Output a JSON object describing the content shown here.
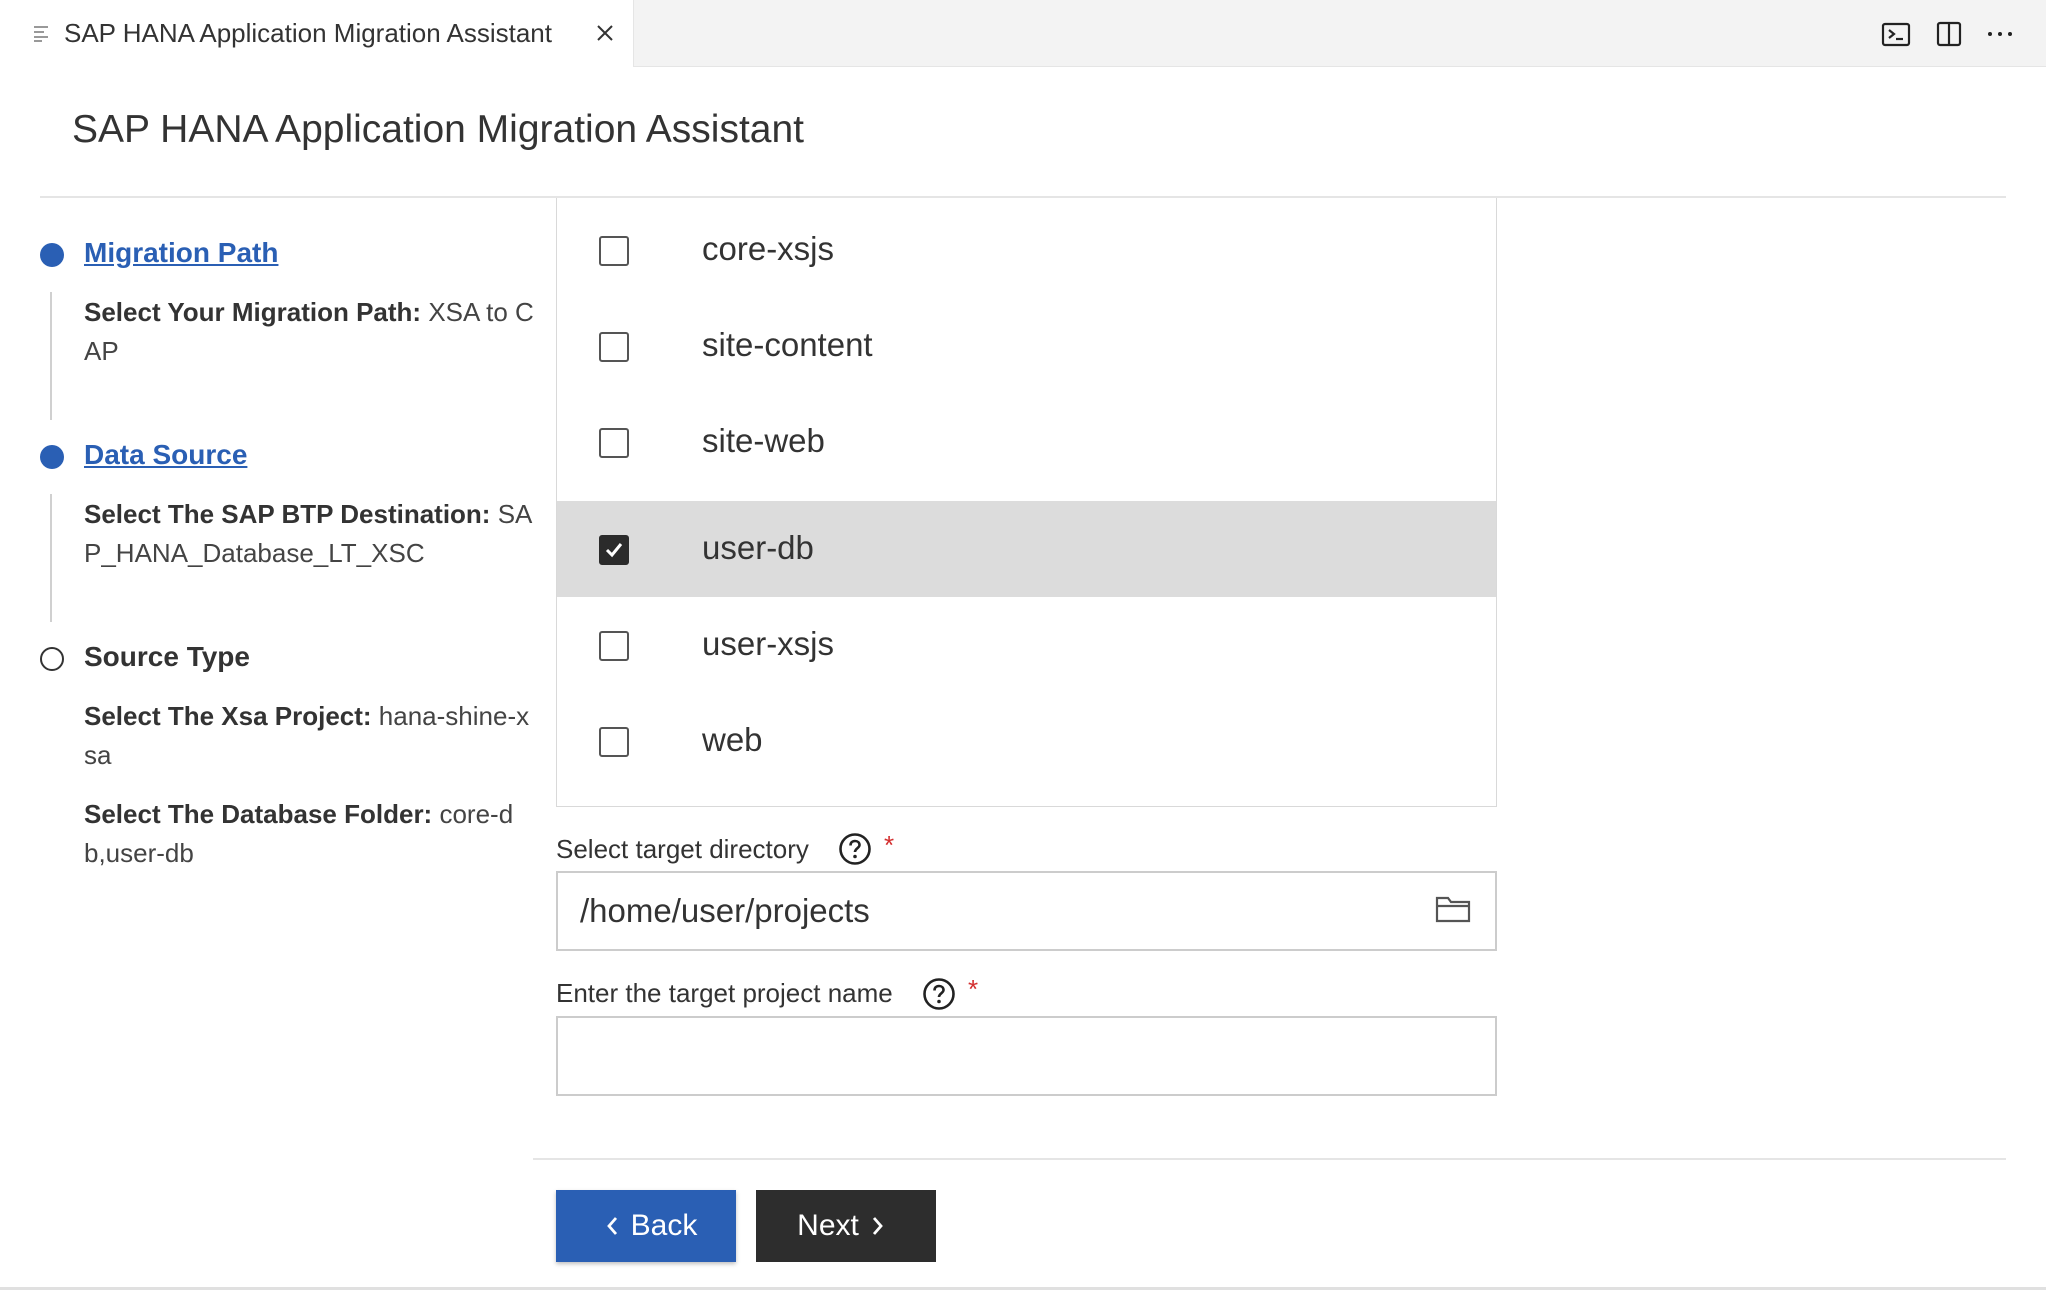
{
  "tab": {
    "icon": "lines-icon",
    "title": "SAP HANA Application Migration Assistant",
    "close_icon": "close-icon"
  },
  "toolbar": {
    "icons": [
      "terminal-icon",
      "split-editor-icon",
      "more-actions-icon"
    ]
  },
  "page": {
    "title": "SAP HANA Application Migration Assistant"
  },
  "steps": [
    {
      "title": "Migration Path",
      "state": "done",
      "details": [
        {
          "label": "Select Your Migration Path:",
          "value": "XSA to CAP"
        }
      ]
    },
    {
      "title": "Data Source",
      "state": "done",
      "details": [
        {
          "label": "Select The SAP BTP Destination:",
          "value": "SAP_HANA_Database_LT_XSC"
        }
      ]
    },
    {
      "title": "Source Type",
      "state": "current",
      "details": [
        {
          "label": "Select The Xsa Project:",
          "value": "hana-shine-xsa"
        },
        {
          "label": "Select The Database Folder:",
          "value": "core-db,user-db"
        }
      ]
    }
  ],
  "modules": [
    {
      "label": "core-xsjs",
      "checked": false
    },
    {
      "label": "site-content",
      "checked": false
    },
    {
      "label": "site-web",
      "checked": false
    },
    {
      "label": "user-db",
      "checked": true
    },
    {
      "label": "user-xsjs",
      "checked": false
    },
    {
      "label": "web",
      "checked": false
    }
  ],
  "target_directory": {
    "label": "Select target directory",
    "required_mark": "*",
    "value": "/home/user/projects",
    "help_icon": "help-icon",
    "browse_icon": "folder-icon"
  },
  "project_name": {
    "label": "Enter the target project name",
    "required_mark": "*",
    "value": "",
    "help_icon": "help-icon"
  },
  "buttons": {
    "back": "Back",
    "next": "Next"
  },
  "colors": {
    "accent": "#2a5fb4",
    "next_button": "#2d2d2d",
    "selected_row": "#dcdcdc",
    "required": "#d32f2f"
  }
}
